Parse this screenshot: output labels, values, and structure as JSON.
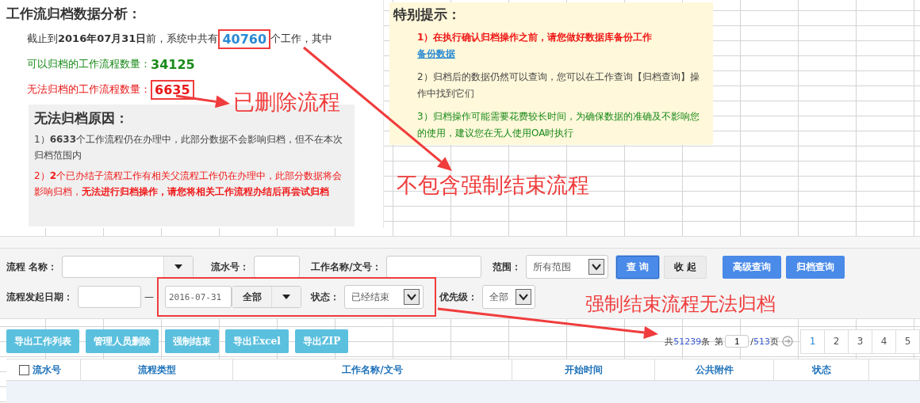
{
  "analysis": {
    "title": "工作流归档数据分析：",
    "summary": {
      "before": "截止到**2016年07月31日**前，系统中共有",
      "total": "40760",
      "after": "个工作，其中"
    },
    "archivable": {
      "label": "可以归档的工作流程数量：",
      "count": "34125"
    },
    "unarchivable": {
      "label": "无法归档的工作流程数量：",
      "count": "6635"
    },
    "reasons": {
      "title": "无法归档原因：",
      "items": [
        {
          "kind": "info",
          "text": "1）**6633**个工作流程仍在办理中，此部分数据不会影响归档，但不在本次归档范围内"
        },
        {
          "kind": "warning",
          "text": "2）**2**个已办结子流程工作有相关父流程工作仍在办理中，此部分数据将会影响归档，**无法进行归档操作，请您将相关工作流程办结后再尝试归档**"
        }
      ]
    }
  },
  "tips": {
    "title": "特别提示：",
    "items": [
      {
        "kind": "warning",
        "text": "1）在执行确认归档操作之前，请您做好数据库备份工作",
        "link": "备份数据"
      },
      {
        "kind": "info",
        "text": "2）归档后的数据仍然可以查询，您可以在工作查询【归档查询】操作中找到它们"
      },
      {
        "kind": "success",
        "text": "3）归档操作可能需要花费较长时间，为确保数据的准确及不影响您的使用，建议您在无人使用OA时执行"
      }
    ]
  },
  "filters": {
    "row_1": [
      {
        "kind": "combo",
        "label": "流程 名称："
      },
      {
        "kind": "input",
        "label": "流水号："
      },
      {
        "kind": "input",
        "label": "工作名称/文号："
      },
      {
        "kind": "select",
        "label": "范围：",
        "value": "所有范围"
      },
      {
        "kind": "primary",
        "text": "查 询"
      },
      {
        "kind": "secondary",
        "text": "收 起"
      },
      {
        "kind": "action",
        "text": "高级查询"
      },
      {
        "kind": "action",
        "text": "归档查询"
      }
    ],
    "row_2": [
      {
        "kind": "input",
        "label": "流程发起日期："
      },
      {
        "kind": "separator",
        "text": "—"
      },
      {
        "kind": "highlight",
        "items": [
          {
            "kind": "input",
            "value": "2016-07-31"
          },
          {
            "kind": "combo",
            "value": "全部"
          },
          {
            "kind": "select",
            "label": "状态：",
            "value": "已经结束"
          }
        ]
      },
      {
        "kind": "select",
        "label": "优先级：",
        "value": "全部"
      }
    ]
  },
  "toolbar": [
    "导出工作列表",
    "管理人员删除",
    "强制结束",
    "导出Excel",
    "导出ZIP"
  ],
  "pager": {
    "total_prefix": "共",
    "total": "51239",
    "total_suffix": "条",
    "page_prefix": "第",
    "page": "1",
    "slash": "/",
    "pages": "513",
    "page_suffix": "页",
    "page_links": [
      {
        "label": "1",
        "selected": true
      },
      {
        "label": "2",
        "selected": false
      },
      {
        "label": "3",
        "selected": false
      },
      {
        "label": "4",
        "selected": false
      },
      {
        "label": "5",
        "selected": false
      }
    ]
  },
  "table": {
    "select_all": {
      "checked": false
    },
    "columns": [
      "流水号",
      "流程类型",
      "工作名称/文号",
      "开始时间",
      "公共附件",
      "状态"
    ]
  },
  "annotations": [
    "已删除流程",
    "不包含强制结束流程",
    "强制结束流程无法归档"
  ]
}
